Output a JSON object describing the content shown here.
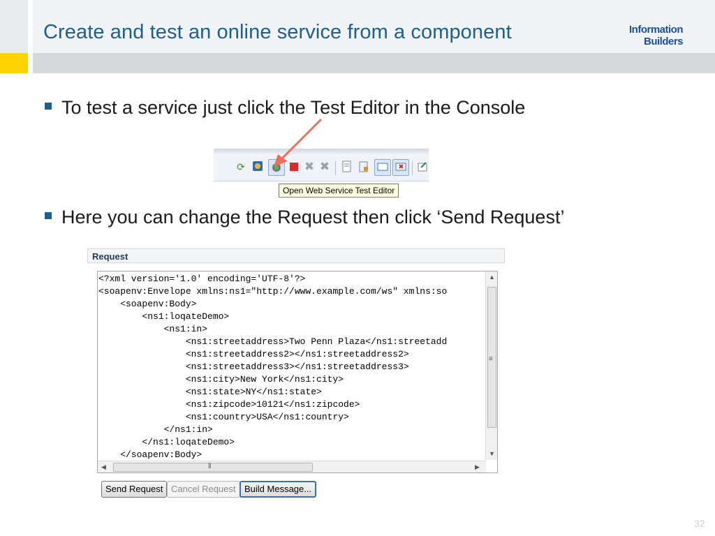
{
  "slide": {
    "title": "Create and test an online service from a component",
    "logo_line1": "Information",
    "logo_line2": "Builders",
    "page_number": "32"
  },
  "bullets": [
    "To test a service just click the Test Editor in the Console",
    "Here you can change the Request then click ‘Send Request’"
  ],
  "toolbar": {
    "tooltip": "Open Web Service Test Editor",
    "icons": [
      "refresh-icon",
      "run-icon",
      "test-editor-icon",
      "stop-icon",
      "remove-icon",
      "remove-all-icon",
      "document-icon",
      "lock-icon",
      "console-icon",
      "console-error-icon",
      "open-icon"
    ]
  },
  "request": {
    "panel_title": "Request",
    "xml_lines": [
      "<?xml version='1.0' encoding='UTF-8'?>",
      "<soapenv:Envelope xmlns:ns1=\"http://www.example.com/ws\" xmlns:so",
      "    <soapenv:Body>",
      "        <ns1:loqateDemo>",
      "            <ns1:in>",
      "                <ns1:streetaddress>Two Penn Plaza</ns1:streetadd",
      "                <ns1:streetaddress2></ns1:streetaddress2>",
      "                <ns1:streetaddress3></ns1:streetaddress3>",
      "                <ns1:city>New York</ns1:city>",
      "                <ns1:state>NY</ns1:state>",
      "                <ns1:zipcode>10121</ns1:zipcode>",
      "                <ns1:country>USA</ns1:country>",
      "            </ns1:in>",
      "        </ns1:loqateDemo>",
      "    </soapenv:Body>"
    ],
    "buttons": {
      "send": "Send Request",
      "cancel": "Cancel Request",
      "build": "Build Message..."
    }
  },
  "colors": {
    "title": "#1f5f8b",
    "accent_yellow": "#ffd200",
    "arrow": "#e8705c"
  }
}
